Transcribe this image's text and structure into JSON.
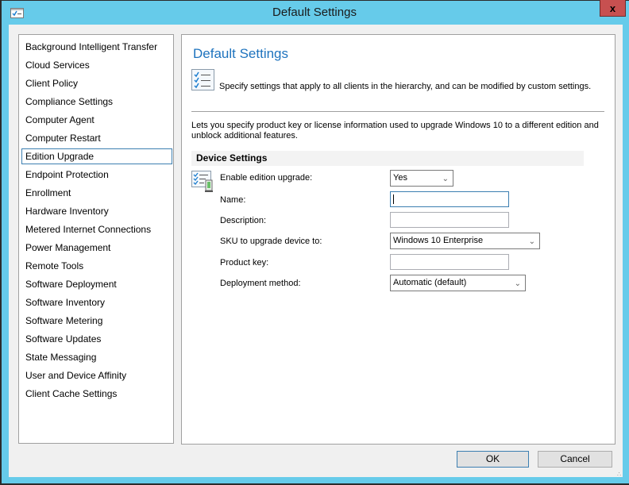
{
  "window": {
    "title": "Default Settings",
    "close_label": "x",
    "app_icon": "checklist-window-icon"
  },
  "sidebar": {
    "items": [
      {
        "label": "Background Intelligent Transfer",
        "selected": false
      },
      {
        "label": "Cloud Services",
        "selected": false
      },
      {
        "label": "Client Policy",
        "selected": false
      },
      {
        "label": "Compliance Settings",
        "selected": false
      },
      {
        "label": "Computer Agent",
        "selected": false
      },
      {
        "label": "Computer Restart",
        "selected": false
      },
      {
        "label": "Edition Upgrade",
        "selected": true
      },
      {
        "label": "Endpoint Protection",
        "selected": false
      },
      {
        "label": "Enrollment",
        "selected": false
      },
      {
        "label": "Hardware Inventory",
        "selected": false
      },
      {
        "label": "Metered Internet Connections",
        "selected": false
      },
      {
        "label": "Power Management",
        "selected": false
      },
      {
        "label": "Remote Tools",
        "selected": false
      },
      {
        "label": "Software Deployment",
        "selected": false
      },
      {
        "label": "Software Inventory",
        "selected": false
      },
      {
        "label": "Software Metering",
        "selected": false
      },
      {
        "label": "Software Updates",
        "selected": false
      },
      {
        "label": "State Messaging",
        "selected": false
      },
      {
        "label": "User and Device Affinity",
        "selected": false
      },
      {
        "label": "Client Cache Settings",
        "selected": false
      }
    ]
  },
  "main": {
    "title": "Default Settings",
    "description": "Specify settings that apply to all clients in the hierarchy, and can be modified by custom settings.",
    "info": "Lets you specify product key or license information used to upgrade Windows 10 to a different edition and unblock additional features.",
    "section_title": "Device Settings",
    "fields": {
      "enable": {
        "label": "Enable edition upgrade:",
        "value": "Yes"
      },
      "name": {
        "label": "Name:",
        "value": ""
      },
      "description": {
        "label": "Description:",
        "value": ""
      },
      "sku": {
        "label": "SKU to upgrade device to:",
        "value": "Windows 10 Enterprise"
      },
      "product_key": {
        "label": "Product key:",
        "value": ""
      },
      "deployment": {
        "label": "Deployment method:",
        "value": "Automatic (default)"
      }
    }
  },
  "buttons": {
    "ok": "OK",
    "cancel": "Cancel"
  },
  "colors": {
    "title_bar": "#66cbea",
    "close_button": "#c75050",
    "heading": "#1e73be",
    "focus_border": "#3c7fb1"
  }
}
